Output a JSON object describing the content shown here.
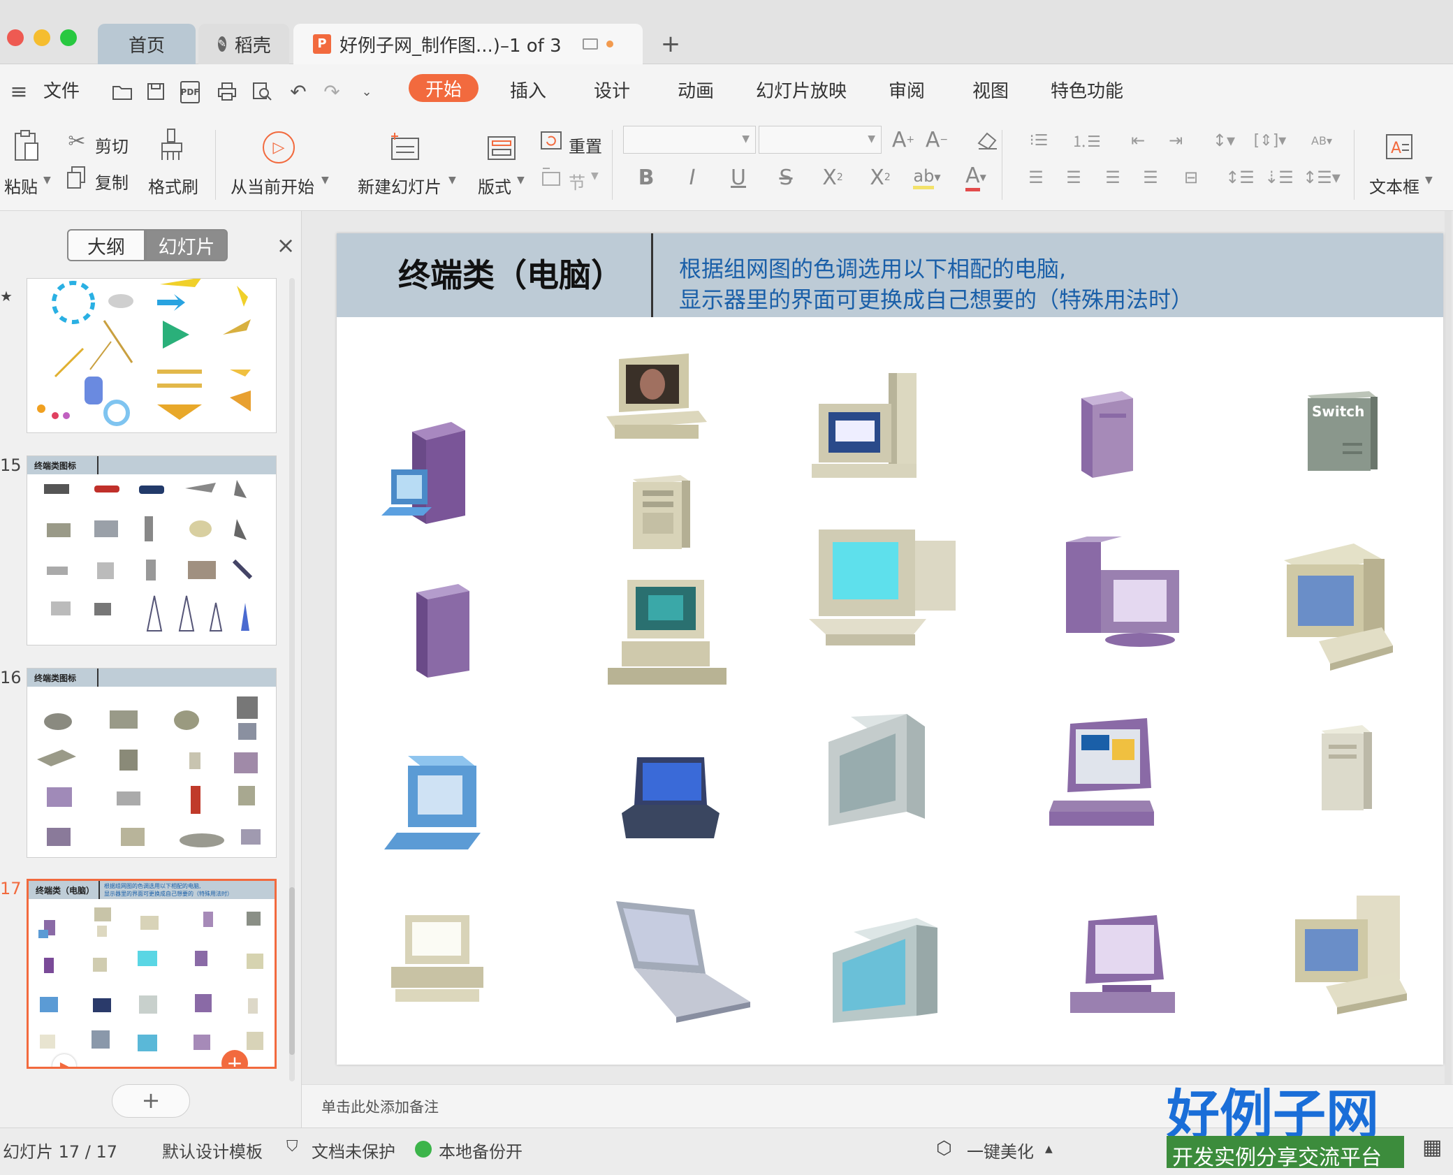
{
  "titlebar": {
    "tabs": [
      {
        "label": "首页"
      },
      {
        "label": "稻壳"
      },
      {
        "label": "好例子网_制作图...)–1 of 3"
      }
    ],
    "new_tab_symbol": "+"
  },
  "menubar": {
    "file_label": "文件",
    "tabs": [
      "开始",
      "插入",
      "设计",
      "动画",
      "幻灯片放映",
      "审阅",
      "视图",
      "特色功能"
    ]
  },
  "ribbon": {
    "paste": "粘贴",
    "cut": "剪切",
    "copy": "复制",
    "format_painter": "格式刷",
    "play_from_current": "从当前开始",
    "new_slide": "新建幻灯片",
    "layout": "版式",
    "reset": "重置",
    "section": "节",
    "textbox": "文本框"
  },
  "left_panel": {
    "view_outline": "大纲",
    "view_slides": "幻灯片",
    "close_symbol": "×",
    "slides": [
      {
        "number": "",
        "title": ""
      },
      {
        "number": "15",
        "title": "终端类图标"
      },
      {
        "number": "16",
        "title": "终端类图标"
      },
      {
        "number": "17",
        "title": "终端类（电脑）",
        "subtitle1": "根据组网图的色调选用以下相配的电脑,",
        "subtitle2": "显示器里的界面可更换成自己想要的（特殊用法时）"
      }
    ],
    "add_symbol": "+"
  },
  "slide": {
    "title": "终端类（电脑）",
    "subtitle_line1": "根据组网图的色调选用以下相配的电脑,",
    "subtitle_line2": "显示器里的界面可更换成自己想要的（特殊用法时）",
    "switch_label": "Switch"
  },
  "notes": {
    "placeholder": "单击此处添加备注"
  },
  "statusbar": {
    "slide_label": "幻灯片 17 / 17",
    "template": "默认设计模板",
    "protection": "文档未保护",
    "backup": "本地备份开",
    "beautify": "一键美化"
  },
  "watermark": {
    "line1": "好例子网",
    "line2": "开发实例分享交流平台"
  },
  "colors": {
    "accent": "#f26a3e",
    "slide_header": "#bdcbd6",
    "subtitle": "#1a5fa8",
    "purple": "#8a6aa6",
    "beige": "#d8d3b8",
    "blue": "#5b9bd5"
  }
}
